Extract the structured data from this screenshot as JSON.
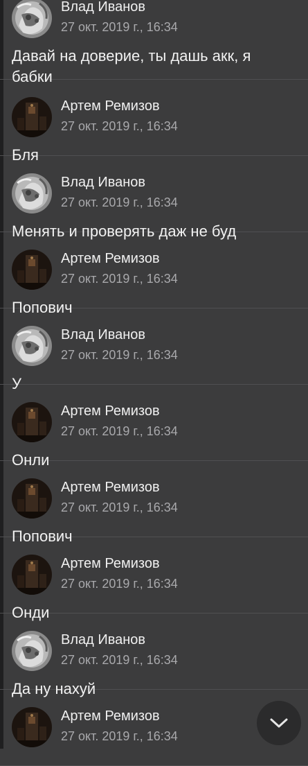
{
  "messages": [
    {
      "author": "Влад Иванов",
      "time": "27 окт. 2019 г., 16:34",
      "text": "Давай на доверие, ты дашь акк, я бабки",
      "avatar": "vlad"
    },
    {
      "author": "Артем Ремизов",
      "time": "27 окт. 2019 г., 16:34",
      "text": "Бля",
      "avatar": "artem"
    },
    {
      "author": "Влад Иванов",
      "time": "27 окт. 2019 г., 16:34",
      "text": "Менять и проверять даж не буд",
      "avatar": "vlad"
    },
    {
      "author": "Артем Ремизов",
      "time": "27 окт. 2019 г., 16:34",
      "text": "Попович",
      "avatar": "artem"
    },
    {
      "author": "Влад Иванов",
      "time": "27 окт. 2019 г., 16:34",
      "text": "У",
      "avatar": "vlad"
    },
    {
      "author": "Артем Ремизов",
      "time": "27 окт. 2019 г., 16:34",
      "text": "Онли",
      "avatar": "artem"
    },
    {
      "author": "Артем Ремизов",
      "time": "27 окт. 2019 г., 16:34",
      "text": "Попович",
      "avatar": "artem"
    },
    {
      "author": "Артем Ремизов",
      "time": "27 окт. 2019 г., 16:34",
      "text": "Онди",
      "avatar": "artem"
    },
    {
      "author": "Влад Иванов",
      "time": "27 окт. 2019 г., 16:34",
      "text": "Да ну нахуй",
      "avatar": "vlad"
    },
    {
      "author": "Артем Ремизов",
      "time": "27 окт. 2019 г., 16:34",
      "text": "",
      "avatar": "artem"
    }
  ],
  "scroll_button": {
    "icon": "chevron-down-icon"
  },
  "colors": {
    "background": "#3c3c3d",
    "author_text": "#f0f0f0",
    "time_text": "#a9a9ac",
    "message_text": "#f2f2f2",
    "scroll_button": "#2b2b2c"
  }
}
